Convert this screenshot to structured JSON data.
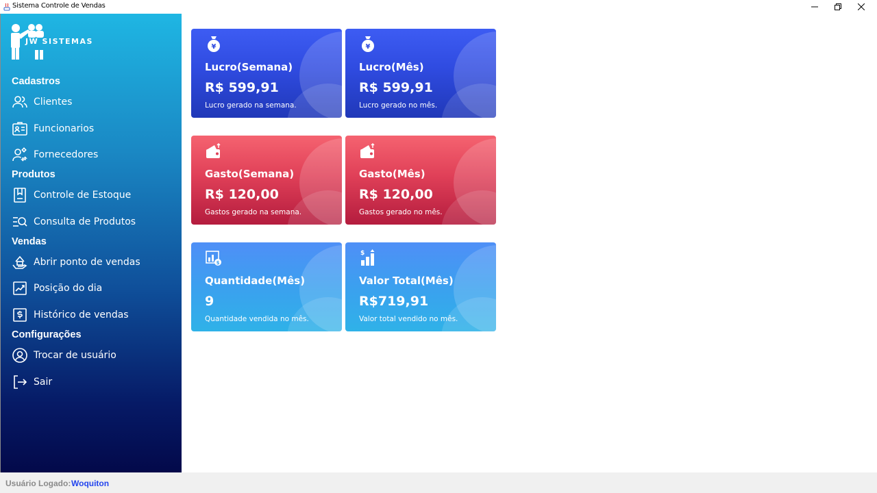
{
  "window": {
    "title": "Sistema Controle de Vendas"
  },
  "logo": {
    "text": "JW SISTEMAS"
  },
  "sidebar": {
    "sections": [
      {
        "title": "Cadastros"
      },
      {
        "title": "Produtos"
      },
      {
        "title": "Vendas"
      },
      {
        "title": "Configurações"
      }
    ],
    "items": [
      {
        "label": "Clientes",
        "icon": "users-icon"
      },
      {
        "label": "Funcionarios",
        "icon": "id-card-icon"
      },
      {
        "label": "Fornecedores",
        "icon": "supplier-icon"
      },
      {
        "label": "Controle de Estoque",
        "icon": "bookmark-icon"
      },
      {
        "label": "Consulta de Produtos",
        "icon": "search-list-icon"
      },
      {
        "label": "Abrir ponto de vendas",
        "icon": "hand-store-icon"
      },
      {
        "label": "Posição do dia",
        "icon": "trend-chart-icon"
      },
      {
        "label": "Histórico de vendas",
        "icon": "dollar-box-icon"
      },
      {
        "label": "Trocar de usuário",
        "icon": "user-circle-icon"
      },
      {
        "label": "Sair",
        "icon": "logout-icon"
      }
    ]
  },
  "cards": [
    {
      "title": "Lucro(Semana)",
      "value": "R$ 599,91",
      "description": "Lucro gerado na semana.",
      "icon": "money-bag-icon",
      "theme": "blue"
    },
    {
      "title": "Lucro(Mês)",
      "value": "R$ 599,91",
      "description": "Lucro gerado no mês.",
      "icon": "money-bag-icon",
      "theme": "blue"
    },
    {
      "title": "Gasto(Semana)",
      "value": "R$ 120,00",
      "description": "Gastos gerado na semana.",
      "icon": "wallet-icon",
      "theme": "red"
    },
    {
      "title": "Gasto(Mês)",
      "value": "R$ 120,00",
      "description": "Gastos gerado no mês.",
      "icon": "wallet-icon",
      "theme": "red"
    },
    {
      "title": "Quantidade(Mês)",
      "value": "9",
      "description": "Quantidade vendida no mês.",
      "icon": "chart-coin-icon",
      "theme": "sky"
    },
    {
      "title": "Valor Total(Mês)",
      "value": "R$719,91",
      "description": "Valor total vendido no mês.",
      "icon": "bars-up-icon",
      "theme": "sky"
    }
  ],
  "status": {
    "label": "Usuário Logado:",
    "user": "Woquiton"
  },
  "colors": {
    "blue_card": "#2f4be0",
    "red_card": "#e04058",
    "sky_card": "#3ba0ef",
    "sidebar_top": "#1fb6e3",
    "sidebar_bottom": "#03094a",
    "status_user": "#2244ee"
  }
}
